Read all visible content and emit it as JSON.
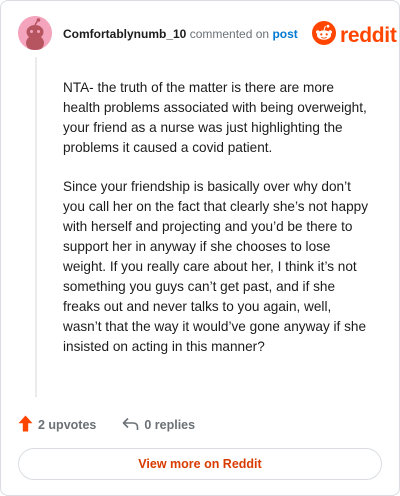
{
  "comment": {
    "username": "Comfortablynumb_10",
    "action_text": "commented on",
    "post_link": "post",
    "paragraphs": [
      "NTA- the truth of the matter is there are more health problems associated with being overweight, your friend as a nurse was just highlighting the problems it caused a covid patient.",
      "Since your friendship is basically over why don’t you call her on the fact that clearly she’s not happy with herself and projecting and you’d be there to support her in anyway if she chooses to lose weight. If you really care about her, I think it’s not something you guys can’t get past, and if she freaks out and never talks to you again, well, wasn’t that the way it would’ve gone anyway if she insisted on acting in this manner?"
    ],
    "upvotes": "2 upvotes",
    "replies": "0 replies"
  },
  "brand": {
    "name": "reddit",
    "color": "#ff4500"
  },
  "view_more_label": "View more on Reddit",
  "colors": {
    "accent": "#ff4500",
    "link": "#0079d3",
    "muted": "#6b7176",
    "button_text": "#d93a00"
  },
  "icons": {
    "avatar": "snoo-avatar",
    "logo": "reddit-logo-icon",
    "upvote": "upvote-arrow-icon",
    "reply": "reply-arrow-icon"
  }
}
